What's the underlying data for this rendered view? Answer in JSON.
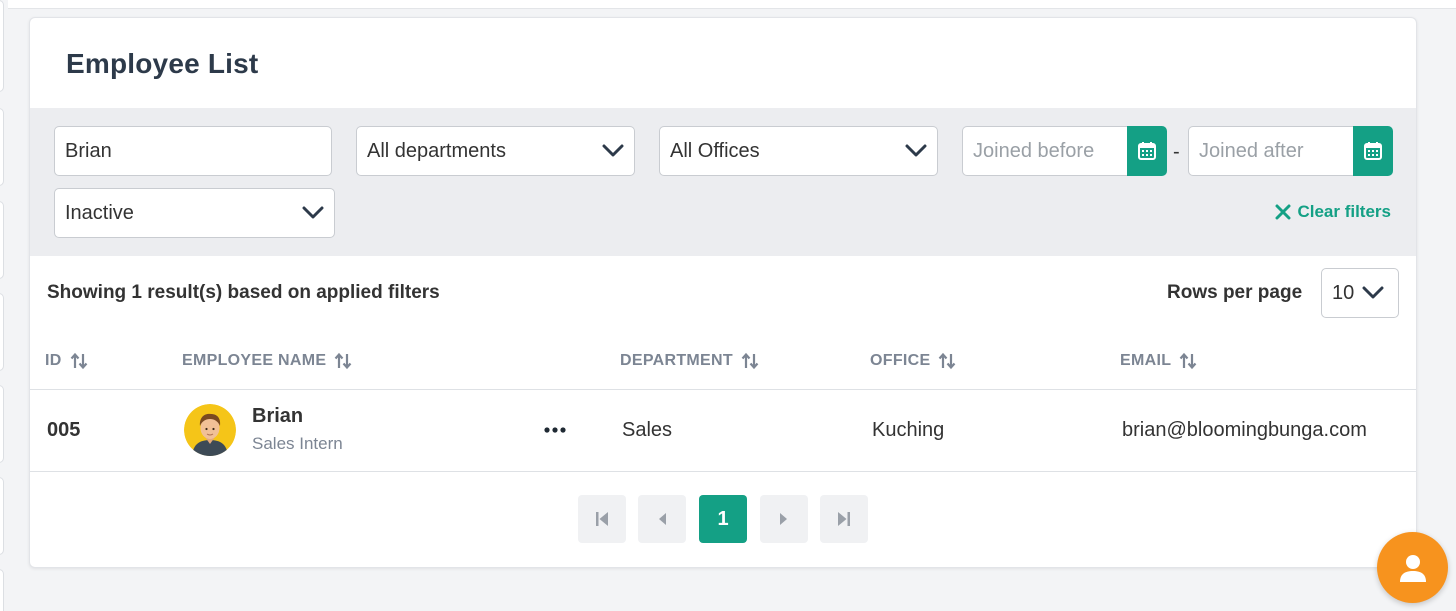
{
  "card": {
    "title": "Employee List"
  },
  "filters": {
    "search_value": "Brian",
    "department_value": "All departments",
    "office_value": "All Offices",
    "joined_before_placeholder": "Joined before",
    "joined_after_placeholder": "Joined after",
    "date_separator": "-",
    "status_value": "Inactive",
    "clear_label": "Clear filters"
  },
  "results": {
    "summary": "Showing 1 result(s) based on applied filters",
    "rows_per_page_label": "Rows per page",
    "rows_per_page_value": "10"
  },
  "table": {
    "columns": [
      "ID",
      "EMPLOYEE NAME",
      "DEPARTMENT",
      "OFFICE",
      "EMAIL"
    ],
    "rows": [
      {
        "id": "005",
        "name": "Brian",
        "role": "Sales Intern",
        "department": "Sales",
        "office": "Kuching",
        "email": "brian@bloomingbunga.com"
      }
    ]
  },
  "pagination": {
    "current_page": "1"
  },
  "colors": {
    "accent": "#14a085",
    "fab": "#f7931e",
    "filter_bg": "#ecedf0",
    "header_text": "#7c8593"
  },
  "icons": [
    "calendar-icon",
    "chevron-down-icon",
    "close-icon",
    "sort-icon",
    "more-icon",
    "first-page-icon",
    "prev-page-icon",
    "next-page-icon",
    "last-page-icon",
    "user-icon"
  ]
}
